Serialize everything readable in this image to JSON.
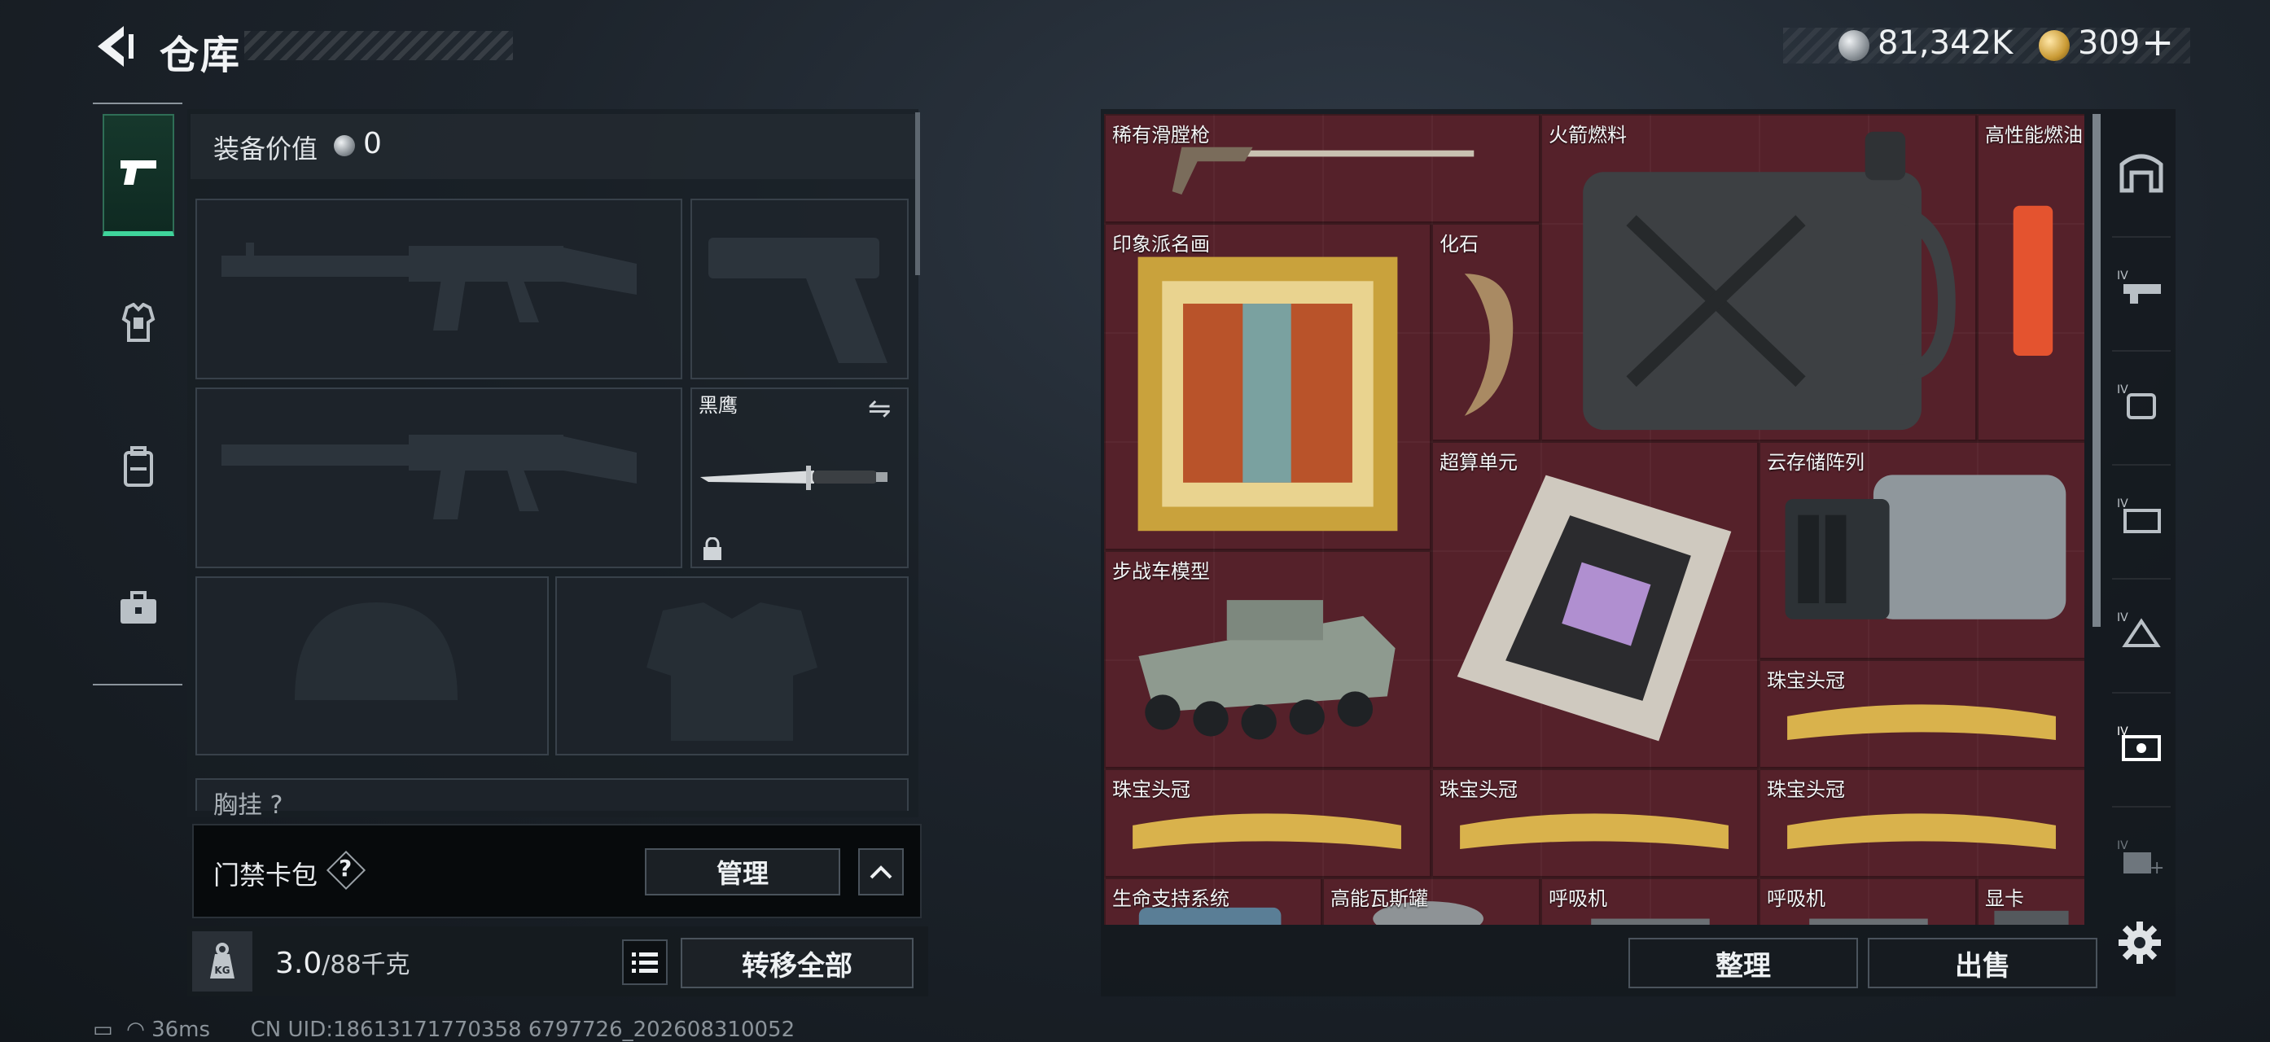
{
  "header": {
    "title": "仓库",
    "currency_silver": "81,342K",
    "currency_gold": "309",
    "plus_label": "+"
  },
  "loadout": {
    "equip_value_label": "装备价值",
    "equip_value": "0",
    "melee_name": "黑鹰",
    "chest_label": "胸挂 ?"
  },
  "keycard": {
    "label": "门禁卡包",
    "help": "?",
    "manage_label": "管理"
  },
  "weight": {
    "current": "3.0",
    "max": "/88千克",
    "transfer_label": "转移全部"
  },
  "status": {
    "ping": "36ms",
    "uid": "CN UID:18613171770358 6797726_202608310052"
  },
  "stash": {
    "items": [
      {
        "label": "稀有滑膛枪"
      },
      {
        "label": "火箭燃料"
      },
      {
        "label": "高性能燃油"
      },
      {
        "label": "印象派名画"
      },
      {
        "label": "化石"
      },
      {
        "label": "超算单元"
      },
      {
        "label": "云存储阵列"
      },
      {
        "label": "步战车模型"
      },
      {
        "label": "珠宝头冠"
      },
      {
        "label": "珠宝头冠"
      },
      {
        "label": "珠宝头冠"
      },
      {
        "label": "珠宝头冠"
      },
      {
        "label": "生命支持系统"
      },
      {
        "label": "高能瓦斯罐"
      },
      {
        "label": "呼吸机"
      },
      {
        "label": "呼吸机"
      },
      {
        "label": "显卡"
      }
    ],
    "sort_label": "整理",
    "sell_label": "出售"
  },
  "colors": {
    "accent_green": "#3fd49b",
    "stash_bg": "#4a2027"
  }
}
